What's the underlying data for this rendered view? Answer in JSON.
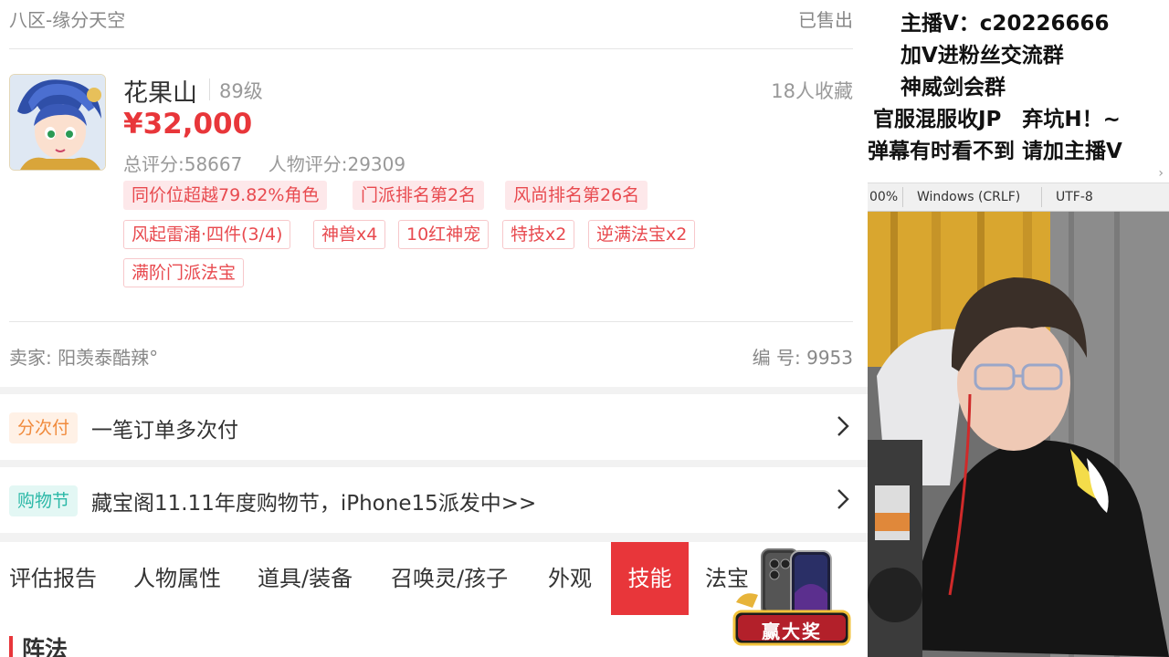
{
  "listing": {
    "region": "八区-缘分天空",
    "status": "已售出",
    "character_name": "花果山",
    "level": "89级",
    "favorites": "18人收藏",
    "price": "¥32,000",
    "total_score": "总评分:58667",
    "char_score": "人物评分:29309",
    "tags": [
      "同价位超越79.82%角色",
      "门派排名第2名",
      "风尚排名第26名",
      "风起雷涌·四件(3/4)",
      "神兽x4",
      "10红神宠",
      "特技x2",
      "逆满法宝x2",
      "满阶门派法宝"
    ],
    "seller": "卖家: 阳羡泰酷辣°",
    "serial": "编 号: 9953"
  },
  "promos": [
    {
      "badge": "分次付",
      "text": "一笔订单多次付",
      "badge_color": "#f08a3c",
      "badge_bg": "#fff1e6"
    },
    {
      "badge": "购物节",
      "text": "藏宝阁11.11年度购物节，iPhone15派发中>>",
      "badge_color": "#2bb8a7",
      "badge_bg": "#e3f7f4"
    }
  ],
  "tabs": [
    "评估报告",
    "人物属性",
    "道具/装备",
    "召唤灵/孩子",
    "外观",
    "技能",
    "法宝"
  ],
  "active_tab": "技能",
  "section_title": "阵法",
  "gift_label": "赢大奖",
  "stream": {
    "notes": [
      "主播V：c20226666",
      "加V进粉丝交流群",
      "神威剑会群",
      "官服混服收JP　弃坑H！~",
      "弹幕有时看不到 请加主播V"
    ],
    "status": {
      "zoom": "00%",
      "line_ending": "Windows (CRLF)",
      "encoding": "UTF-8"
    }
  },
  "colors": {
    "accent": "#e8363a",
    "tag_text": "#e84a4f"
  }
}
